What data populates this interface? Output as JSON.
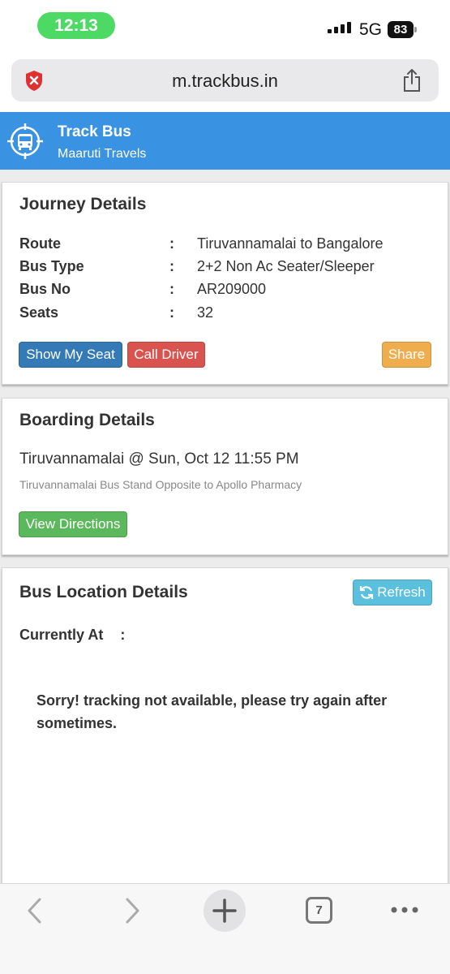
{
  "status": {
    "time": "12:13",
    "network": "5G",
    "battery": "83"
  },
  "browser": {
    "url": "m.trackbus.in",
    "tab_count": "7"
  },
  "app": {
    "title": "Track Bus",
    "subtitle": "Maaruti Travels"
  },
  "journey": {
    "title": "Journey Details",
    "rows": [
      {
        "label": "Route",
        "value": "Tiruvannamalai to Bangalore"
      },
      {
        "label": "Bus Type",
        "value": "2+2 Non Ac Seater/Sleeper"
      },
      {
        "label": "Bus No",
        "value": "AR209000"
      },
      {
        "label": "Seats",
        "value": "32"
      }
    ],
    "separator": ":",
    "buttons": {
      "show_seat": "Show My Seat",
      "call_driver": "Call Driver",
      "share": "Share"
    }
  },
  "boarding": {
    "title": "Boarding Details",
    "place": "Tiruvannamalai @ Sun, Oct 12 11:55 PM",
    "address": "Tiruvannamalai Bus Stand Opposite to Apollo Pharmacy",
    "directions_button": "View Directions"
  },
  "location": {
    "title": "Bus Location Details",
    "refresh_button": "Refresh",
    "currently_at_label": "Currently At",
    "separator": ":",
    "message": "Sorry! tracking not available, please try again after sometimes."
  },
  "colors": {
    "header": "#3a93e2",
    "primary": "#337ab7",
    "danger": "#d9534f",
    "warning": "#f0ad4e",
    "success": "#5cb85c",
    "info": "#5bc0de",
    "status_pill": "#4cd964"
  },
  "icons": {
    "privacy": "shield-x-icon",
    "share": "share-icon",
    "logo": "bus-target-icon",
    "refresh": "refresh-icon",
    "back": "chevron-left-icon",
    "forward": "chevron-right-icon",
    "new_tab": "plus-icon",
    "more": "more-icon"
  }
}
